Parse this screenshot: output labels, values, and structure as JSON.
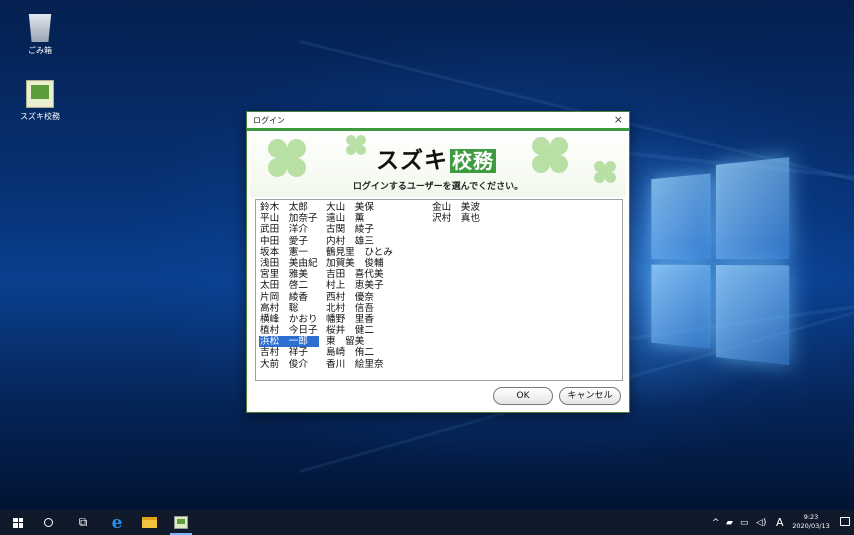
{
  "desktop": {
    "icons": [
      {
        "label": "ごみ箱",
        "icon": "recycle-bin-icon"
      },
      {
        "label": "スズキ校務",
        "icon": "suzuki-koumu-app-icon"
      }
    ]
  },
  "dialog": {
    "title": "ログイン",
    "close_label": "×",
    "logo_main": "スズキ",
    "logo_sub": "校務",
    "prompt": "ログインするユーザーを選んでください。",
    "users": [
      [
        "鈴木　太郎",
        "平山　加奈子",
        "武田　洋介",
        "中田　愛子",
        "坂本　憲一",
        "浅田　美由紀",
        "宮里　雅美",
        "太田　啓二",
        "片岡　綾香",
        "高村　聡",
        "横峰　かおり",
        "植村　今日子",
        "浜松　一郎",
        "吉村　祥子",
        "大前　俊介"
      ],
      [
        "大山　美保",
        "遠山　薫",
        "古関　綾子",
        "内村　雄三",
        "鶴見里　ひとみ",
        "加賀美　俊輔",
        "吉田　喜代美",
        "村上　恵美子",
        "西村　優奈",
        "北村　信吾",
        "幡野　里香",
        "桜井　健二",
        "東　留美",
        "島崎　侑二",
        "香川　絵里奈"
      ],
      [
        "金山　美波",
        "沢村　真也"
      ]
    ],
    "selected_user": "浜松　一郎",
    "ok_label": "OK",
    "cancel_label": "キャンセル"
  },
  "taskbar": {
    "pinned": [
      "start-icon",
      "search-icon",
      "task-view-icon",
      "edge-icon",
      "file-explorer-icon",
      "suzuki-koumu-app-icon"
    ],
    "tray_chevron": "^",
    "ime": "A",
    "time": "9:23",
    "date": "2020/03/13"
  }
}
